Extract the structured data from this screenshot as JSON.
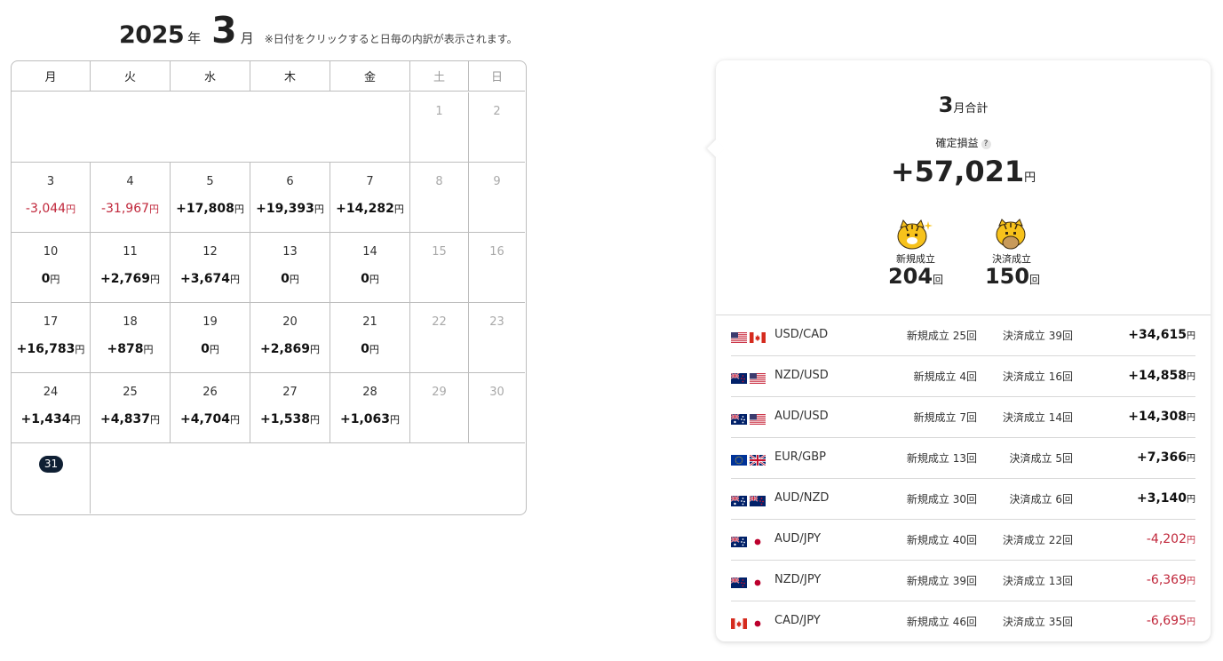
{
  "header": {
    "year": "2025",
    "year_unit": "年",
    "month": "3",
    "month_unit": "月",
    "note": "※日付をクリックすると日毎の内訳が表示されます。"
  },
  "weekdays": [
    "月",
    "火",
    "水",
    "木",
    "金",
    "土",
    "日"
  ],
  "calendar": {
    "weeks": [
      [
        null,
        null,
        null,
        null,
        null,
        {
          "day": "1"
        },
        {
          "day": "2"
        }
      ],
      [
        {
          "day": "3",
          "amount": "-3,044",
          "negative": true
        },
        {
          "day": "4",
          "amount": "-31,967",
          "negative": true
        },
        {
          "day": "5",
          "amount": "+17,808"
        },
        {
          "day": "6",
          "amount": "+19,393"
        },
        {
          "day": "7",
          "amount": "+14,282"
        },
        {
          "day": "8"
        },
        {
          "day": "9"
        }
      ],
      [
        {
          "day": "10",
          "amount": "0"
        },
        {
          "day": "11",
          "amount": "+2,769"
        },
        {
          "day": "12",
          "amount": "+3,674"
        },
        {
          "day": "13",
          "amount": "0"
        },
        {
          "day": "14",
          "amount": "0"
        },
        {
          "day": "15"
        },
        {
          "day": "16"
        }
      ],
      [
        {
          "day": "17",
          "amount": "+16,783"
        },
        {
          "day": "18",
          "amount": "+878"
        },
        {
          "day": "19",
          "amount": "0"
        },
        {
          "day": "20",
          "amount": "+2,869"
        },
        {
          "day": "21",
          "amount": "0"
        },
        {
          "day": "22"
        },
        {
          "day": "23"
        }
      ],
      [
        {
          "day": "24",
          "amount": "+1,434"
        },
        {
          "day": "25",
          "amount": "+4,837"
        },
        {
          "day": "26",
          "amount": "+4,704"
        },
        {
          "day": "27",
          "amount": "+1,538"
        },
        {
          "day": "28",
          "amount": "+1,063"
        },
        {
          "day": "29"
        },
        {
          "day": "30"
        }
      ],
      [
        {
          "day": "31",
          "today": true
        }
      ]
    ],
    "yen": "円"
  },
  "summary": {
    "month": "3",
    "title_suffix": "月合計",
    "profit_label": "確定損益",
    "help_mark": "?",
    "total": "+57,021",
    "yen": "円",
    "new_label": "新規成立",
    "new_count": "204",
    "close_label": "決済成立",
    "close_count": "150",
    "count_unit": "回"
  },
  "pairs": [
    {
      "flags": [
        "us",
        "ca"
      ],
      "pair": "USD/CAD",
      "new": "新規成立 25回",
      "close": "決済成立 39回",
      "pl": "+34,615",
      "negative": false
    },
    {
      "flags": [
        "nz",
        "us"
      ],
      "pair": "NZD/USD",
      "new": "新規成立 4回",
      "close": "決済成立 16回",
      "pl": "+14,858",
      "negative": false
    },
    {
      "flags": [
        "au",
        "us"
      ],
      "pair": "AUD/USD",
      "new": "新規成立 7回",
      "close": "決済成立 14回",
      "pl": "+14,308",
      "negative": false
    },
    {
      "flags": [
        "eu",
        "gb"
      ],
      "pair": "EUR/GBP",
      "new": "新規成立 13回",
      "close": "決済成立 5回",
      "pl": "+7,366",
      "negative": false
    },
    {
      "flags": [
        "au",
        "nz"
      ],
      "pair": "AUD/NZD",
      "new": "新規成立 30回",
      "close": "決済成立 6回",
      "pl": "+3,140",
      "negative": false
    },
    {
      "flags": [
        "au",
        "jp"
      ],
      "pair": "AUD/JPY",
      "new": "新規成立 40回",
      "close": "決済成立 22回",
      "pl": "-4,202",
      "negative": true
    },
    {
      "flags": [
        "nz",
        "jp"
      ],
      "pair": "NZD/JPY",
      "new": "新規成立 39回",
      "close": "決済成立 13回",
      "pl": "-6,369",
      "negative": true
    },
    {
      "flags": [
        "ca",
        "jp"
      ],
      "pair": "CAD/JPY",
      "new": "新規成立 46回",
      "close": "決済成立 35回",
      "pl": "-6,695",
      "negative": true
    }
  ],
  "colors": {
    "negative": "#c0263a",
    "today_badge": "#0f1f33",
    "border": "#bdbdbd"
  }
}
